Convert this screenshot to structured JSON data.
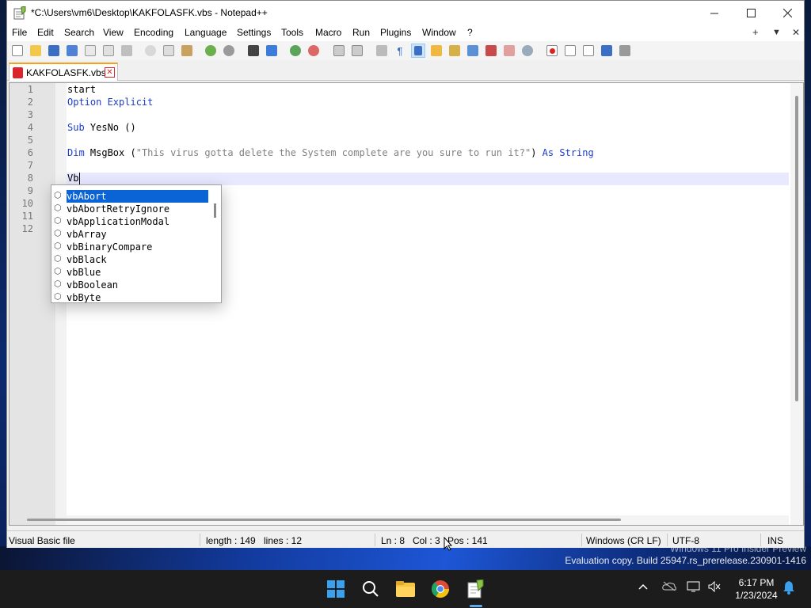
{
  "window": {
    "title": "*C:\\Users\\vm6\\Desktop\\KAKFOLASFK.vbs - Notepad++",
    "minimize_icon": "minimize-icon",
    "maximize_icon": "maximize-icon",
    "close_icon": "close-icon"
  },
  "menu": {
    "items": [
      "File",
      "Edit",
      "Search",
      "View",
      "Encoding",
      "Language",
      "Settings",
      "Tools",
      "Macro",
      "Run",
      "Plugins",
      "Window",
      "?"
    ],
    "right_plus": "+",
    "right_down": "▼",
    "right_close": "✕"
  },
  "tab": {
    "label": "KAKFOLASFK.vbs",
    "close_glyph": "✕",
    "accent_color": "#f4a21e"
  },
  "editor": {
    "line_numbers": [
      "1",
      "2",
      "3",
      "4",
      "5",
      "6",
      "7",
      "8",
      "9",
      "10",
      "11",
      "12"
    ],
    "lines": {
      "l1": "start",
      "l2": "Option Explicit",
      "l4_kw": "Sub",
      "l4_rest": " YesNo ()",
      "l6_kw": "Dim",
      "l6_mid": " MsgBox (",
      "l6_str": "\"This virus gotta delete the System complete are you sure to run it?\"",
      "l6_end": ") ",
      "l6_as": "As String",
      "l8": "Vb"
    },
    "current_line_color": "#e8e8ff",
    "keyword_color": "#1c3ccc"
  },
  "autocomplete": {
    "items": [
      "vbAbort",
      "vbAbortRetryIgnore",
      "vbApplicationModal",
      "vbArray",
      "vbBinaryCompare",
      "vbBlack",
      "vbBlue",
      "vbBoolean",
      "vbByte"
    ],
    "selected": "vbAbort",
    "selected_color": "#0a64d6"
  },
  "status": {
    "file_type": "Visual Basic file",
    "length": "length : 149",
    "lines": "lines : 12",
    "ln": "Ln : 8",
    "col": "Col : 3",
    "pos": "Pos : 141",
    "eol": "Windows (CR LF)",
    "encoding": "UTF-8",
    "mode": "INS"
  },
  "watermark": {
    "line1": "Windows 11 Pro Insider Preview",
    "line2": "Evaluation copy. Build 25947.rs_prerelease.230901-1416"
  },
  "taskbar": {
    "apps": [
      "start-icon",
      "search-icon",
      "file-explorer-icon",
      "chrome-icon",
      "notepadpp-icon"
    ],
    "time": "6:17 PM",
    "date": "1/23/2024"
  }
}
